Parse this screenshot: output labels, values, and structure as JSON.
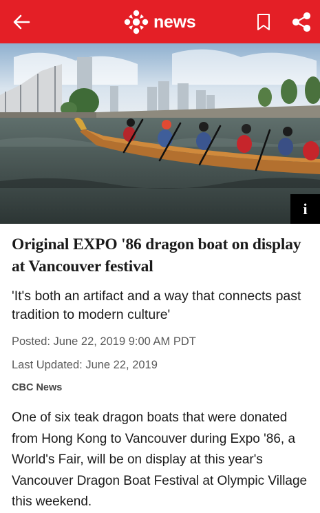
{
  "header": {
    "brand_text": "news",
    "icons": [
      "back-arrow-icon",
      "cbc-gem-logo",
      "bookmark-icon",
      "share-icon"
    ],
    "bar_color": "#e41f26"
  },
  "hero": {
    "image_desc_icon": "i"
  },
  "article": {
    "headline": "Original EXPO '86 dragon boat on display at Vancouver festival",
    "deck": "'It's both an artifact and a way that connects past tradition to modern culture'",
    "posted": "Posted: June 22, 2019 9:00 AM PDT",
    "updated": "Last Updated: June 22, 2019",
    "source": "CBC News",
    "body": "One of six teak dragon boats that were donated from Hong Kong to Vancouver during Expo '86, a World's Fair, will be on display at this year's Vancouver Dragon Boat Festival at Olympic Village this weekend."
  }
}
